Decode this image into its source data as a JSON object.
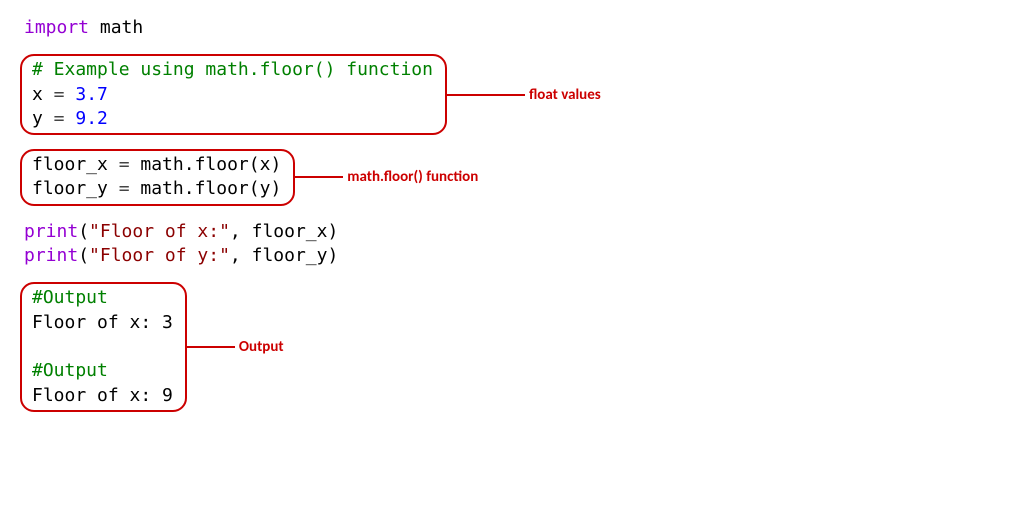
{
  "import_line": {
    "keyword": "import",
    "module": "math"
  },
  "block1": {
    "comment": "# Example using math.floor() function",
    "line_x": {
      "var": "x",
      "eq": " = ",
      "val": "3.7"
    },
    "line_y": {
      "var": "y",
      "eq": " = ",
      "val": "9.2"
    },
    "annotation": "float values"
  },
  "block2": {
    "line_x": {
      "var": "floor_x",
      "eq": " = ",
      "mod": "math",
      "dot": ".",
      "fn": "floor",
      "open": "(",
      "arg": "x",
      "close": ")"
    },
    "line_y": {
      "var": "floor_y",
      "eq": " = ",
      "mod": "math",
      "dot": ".",
      "fn": "floor",
      "open": "(",
      "arg": "y",
      "close": ")"
    },
    "annotation": "math.floor() function"
  },
  "prints": {
    "p1": {
      "fn": "print",
      "open": "(",
      "str": "\"Floor of x:\"",
      "comma": ", ",
      "arg": "floor_x",
      "close": ")"
    },
    "p2": {
      "fn": "print",
      "open": "(",
      "str": "\"Floor of y:\"",
      "comma": ", ",
      "arg": "floor_y",
      "close": ")"
    }
  },
  "output": {
    "c1": "#Output",
    "l1": "Floor of x: 3",
    "c2": "#Output",
    "l2": "Floor of x: 9",
    "annotation": "Output"
  }
}
